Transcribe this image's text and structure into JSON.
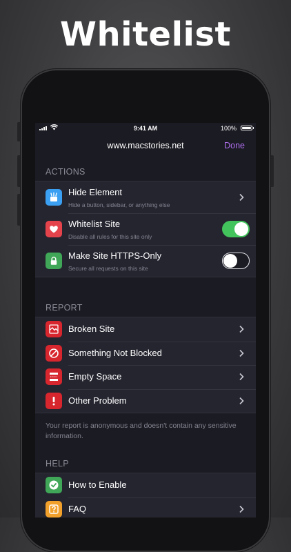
{
  "headline": "Whitelist",
  "status_bar": {
    "time": "9:41 AM",
    "battery": "100%"
  },
  "nav": {
    "title": "www.macstories.net",
    "done": "Done"
  },
  "sections": {
    "actions": {
      "header": "ACTIONS",
      "items": [
        {
          "title": "Hide Element",
          "subtitle": "Hide a button, sidebar, or anything else",
          "icon": "hide-element-icon"
        },
        {
          "title": "Whitelist Site",
          "subtitle": "Disable all rules for this site only",
          "icon": "heart-icon",
          "toggle": true
        },
        {
          "title": "Make Site HTTPS-Only",
          "subtitle": "Secure all requests on this site",
          "icon": "lock-icon",
          "toggle": false
        }
      ]
    },
    "report": {
      "header": "REPORT",
      "items": [
        {
          "title": "Broken Site",
          "icon": "broken-site-icon"
        },
        {
          "title": "Something Not Blocked",
          "icon": "not-blocked-icon"
        },
        {
          "title": "Empty Space",
          "icon": "empty-space-icon"
        },
        {
          "title": "Other Problem",
          "icon": "exclamation-icon"
        }
      ],
      "footer": "Your report is anonymous and doesn't contain any sensitive information."
    },
    "help": {
      "header": "HELP",
      "items": [
        {
          "title": "How to Enable",
          "icon": "checkmark-icon"
        },
        {
          "title": "FAQ",
          "icon": "question-icon"
        }
      ]
    }
  },
  "colors": {
    "accent": "#b06ff0",
    "toggle_on": "#43c35c",
    "screen_bg": "#1b1b23",
    "cell_bg": "#252530",
    "report_icon": "#d7262e"
  }
}
